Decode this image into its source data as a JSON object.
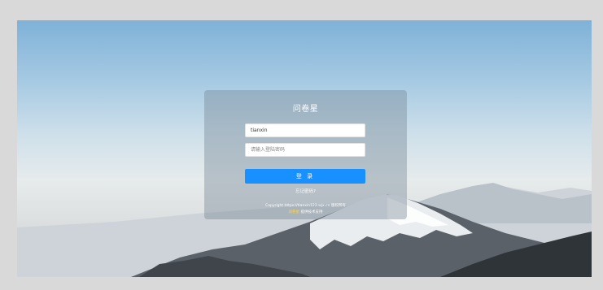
{
  "app": {
    "title": "问卷星"
  },
  "login": {
    "username_value": "tianxin",
    "password_placeholder": "请输入登陆密码",
    "submit_label": "登 录",
    "forgot_label": "忘记密码?"
  },
  "footer": {
    "copyright_line": "Copyright  https://tianxin123.wjx.cn  版权所有",
    "brand": "问卷星",
    "support_text": "提供技术支持"
  },
  "colors": {
    "accent": "#1890ff",
    "brand_text": "#ffd84d"
  }
}
